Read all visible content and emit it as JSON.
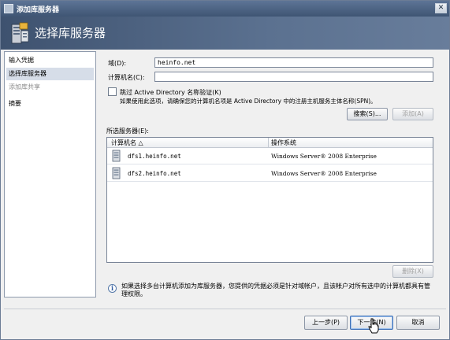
{
  "window": {
    "title": "添加库服务器",
    "close_glyph": "✕"
  },
  "banner": {
    "heading": "选择库服务器"
  },
  "sidebar": {
    "items": [
      {
        "label": "输入凭据",
        "state": "normal"
      },
      {
        "label": "选择库服务器",
        "state": "active"
      },
      {
        "label": "添加库共享",
        "state": "disabled"
      },
      {
        "label": "摘要",
        "state": "normal"
      }
    ]
  },
  "form": {
    "domain_label": "域(D):",
    "domain_value": "heinfo.net",
    "computer_label": "计算机名(C):",
    "computer_value": "",
    "skip_ad_label": "跳过 Active Directory 名称验证(K)",
    "skip_ad_checked": false,
    "skip_ad_note": "如果使用此选项，请确保您的计算机名项是 Active Directory 中的注册主机服务主体名称(SPN)。",
    "search_button": "搜索(S)...",
    "add_button": "添加(A)"
  },
  "selected": {
    "label": "所选服务器(E):",
    "columns": [
      "计算机名 △",
      "操作系统"
    ],
    "rows": [
      {
        "name": "dfs1.heinfo.net",
        "os": "Windows Server® 2008 Enterprise"
      },
      {
        "name": "dfs2.heinfo.net",
        "os": "Windows Server® 2008 Enterprise"
      }
    ],
    "remove_button": "删除(X)"
  },
  "info": {
    "icon": "i",
    "text": "如果选择多台计算机添加为库服务器，您提供的凭据必须是针对域帐户，且该帐户对所有选中的计算机都具有管理权限。"
  },
  "footer": {
    "back_button": "上一步(P)",
    "next_button": "下一步(N)",
    "cancel_button": "取消"
  },
  "colors": {
    "banner": "#4d6383",
    "titlebar": "#46597a",
    "sidebar_active": "#d6dde8",
    "focus_border": "#3d6fb6"
  }
}
